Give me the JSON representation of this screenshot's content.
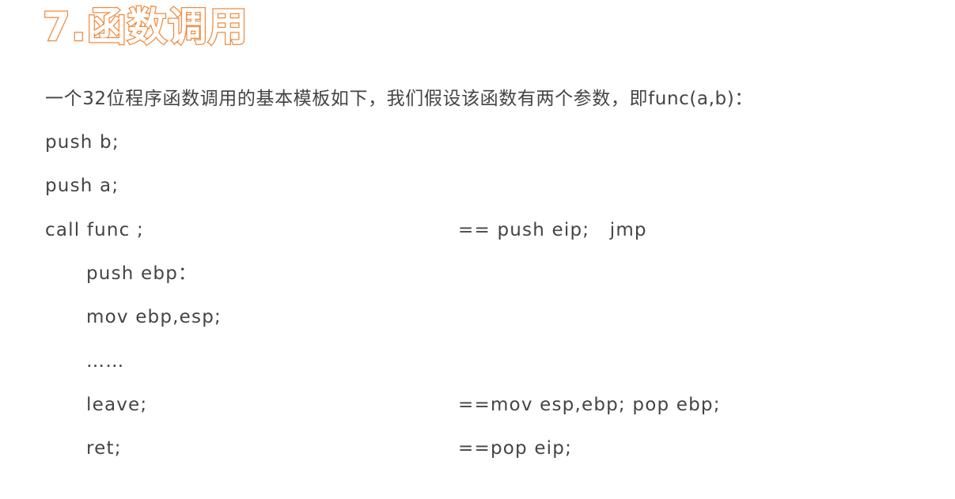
{
  "title": "7.函数调用",
  "intro": "一个32位程序函数调用的基本模板如下，我们假设该函数有两个参数，即func(a,b)：",
  "code_lines": [
    {
      "code": "push b;",
      "comment": ""
    },
    {
      "code": "push a;",
      "comment": ""
    },
    {
      "code": "call func ;",
      "comment": "== push eip;   jmp"
    },
    {
      "code": "push ebp：",
      "comment": ""
    },
    {
      "code": "mov ebp,esp;",
      "comment": ""
    },
    {
      "code": "……",
      "comment": ""
    },
    {
      "code": "leave;",
      "comment": "==mov esp,ebp; pop ebp;"
    },
    {
      "code": "ret;",
      "comment": "==pop eip;"
    }
  ],
  "colors": {
    "title_stroke": "#ef8a3c",
    "body_text": "#444444"
  }
}
